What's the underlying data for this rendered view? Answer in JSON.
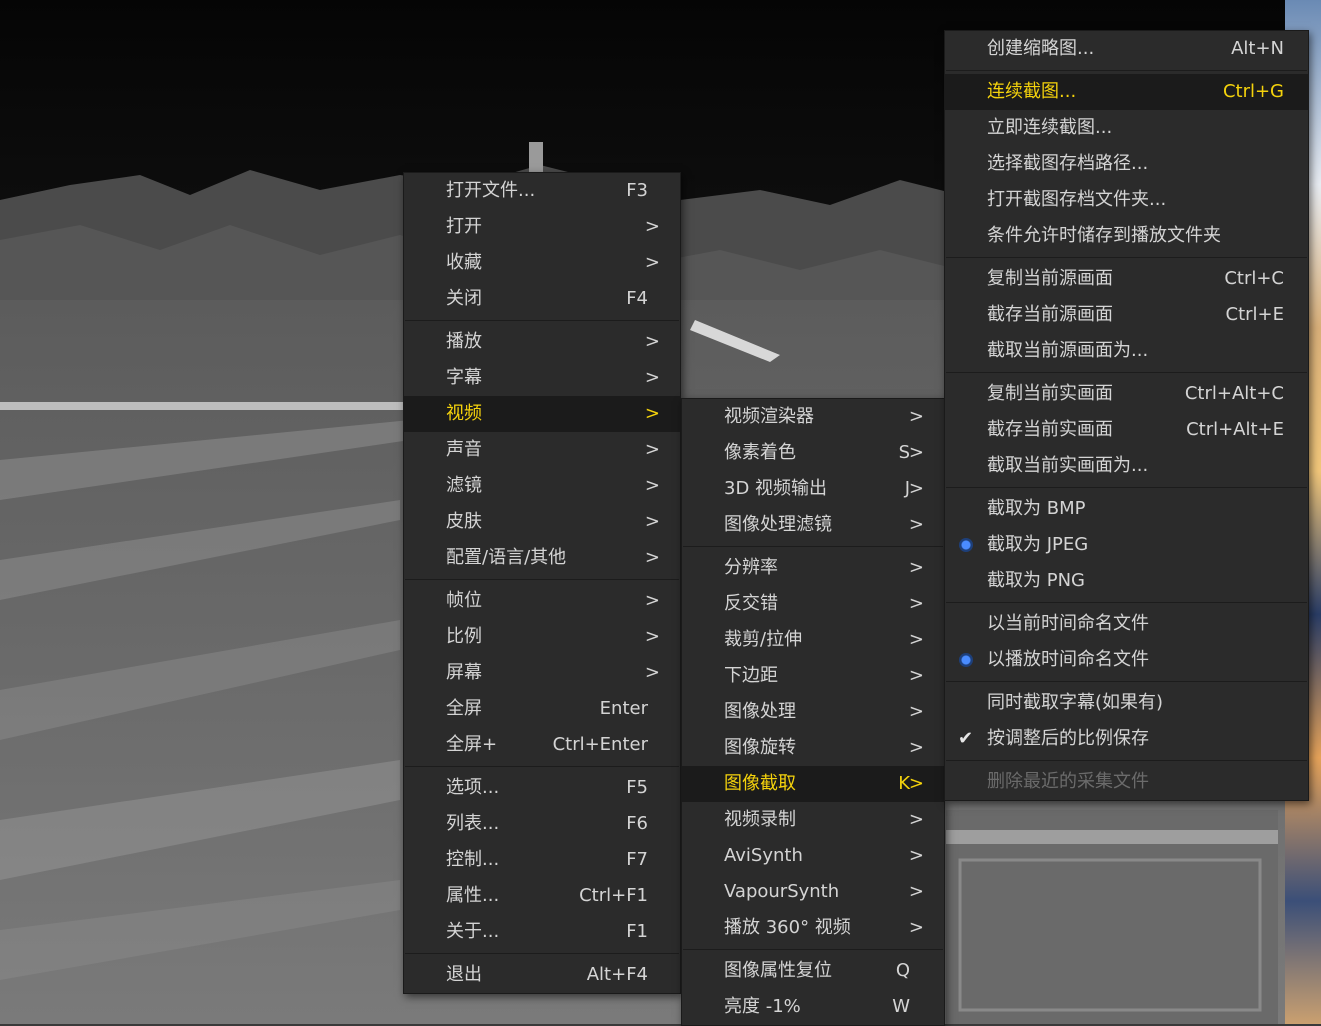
{
  "main_menu": {
    "items": [
      {
        "label": "打开文件...",
        "shortcut": "F3"
      },
      {
        "label": "打开",
        "arrow": ">"
      },
      {
        "label": "收藏",
        "arrow": ">"
      },
      {
        "label": "关闭",
        "shortcut": "F4"
      },
      {
        "label": "播放",
        "arrow": ">"
      },
      {
        "label": "字幕",
        "arrow": ">"
      },
      {
        "label": "视频",
        "arrow": ">"
      },
      {
        "label": "声音",
        "arrow": ">"
      },
      {
        "label": "滤镜",
        "arrow": ">"
      },
      {
        "label": "皮肤",
        "arrow": ">"
      },
      {
        "label": "配置/语言/其他",
        "arrow": ">"
      },
      {
        "label": "帧位",
        "arrow": ">"
      },
      {
        "label": "比例",
        "arrow": ">"
      },
      {
        "label": "屏幕",
        "arrow": ">"
      },
      {
        "label": "全屏",
        "shortcut": "Enter"
      },
      {
        "label": "全屏+",
        "shortcut": "Ctrl+Enter"
      },
      {
        "label": "选项...",
        "shortcut": "F5"
      },
      {
        "label": "列表...",
        "shortcut": "F6"
      },
      {
        "label": "控制...",
        "shortcut": "F7"
      },
      {
        "label": "属性...",
        "shortcut": "Ctrl+F1"
      },
      {
        "label": "关于...",
        "shortcut": "F1"
      },
      {
        "label": "退出",
        "shortcut": "Alt+F4"
      }
    ]
  },
  "video_menu": {
    "items": [
      {
        "label": "视频渲染器",
        "arrow": ">"
      },
      {
        "label": "像素着色",
        "key": "S",
        "arrow": ">"
      },
      {
        "label": "3D 视频输出",
        "key": "J",
        "arrow": ">"
      },
      {
        "label": "图像处理滤镜",
        "arrow": ">"
      },
      {
        "label": "分辨率",
        "arrow": ">"
      },
      {
        "label": "反交错",
        "arrow": ">"
      },
      {
        "label": "裁剪/拉伸",
        "arrow": ">"
      },
      {
        "label": "下边距",
        "arrow": ">"
      },
      {
        "label": "图像处理",
        "arrow": ">"
      },
      {
        "label": "图像旋转",
        "arrow": ">"
      },
      {
        "label": "图像截取",
        "key": "K",
        "arrow": ">"
      },
      {
        "label": "视频录制",
        "arrow": ">"
      },
      {
        "label": "AviSynth",
        "arrow": ">"
      },
      {
        "label": "VapourSynth",
        "arrow": ">"
      },
      {
        "label": "播放 360° 视频",
        "arrow": ">"
      },
      {
        "label": "图像属性复位",
        "shortcut": "Q"
      },
      {
        "label": "亮度 -1%",
        "shortcut": "W"
      }
    ]
  },
  "capture_menu": {
    "items": [
      {
        "label": "创建缩略图...",
        "shortcut": "Alt+N"
      },
      {
        "label": "连续截图...",
        "shortcut": "Ctrl+G"
      },
      {
        "label": "立即连续截图..."
      },
      {
        "label": "选择截图存档路径..."
      },
      {
        "label": "打开截图存档文件夹..."
      },
      {
        "label": "条件允许时储存到播放文件夹"
      },
      {
        "label": "复制当前源画面",
        "shortcut": "Ctrl+C"
      },
      {
        "label": "截存当前源画面",
        "shortcut": "Ctrl+E"
      },
      {
        "label": "截取当前源画面为..."
      },
      {
        "label": "复制当前实画面",
        "shortcut": "Ctrl+Alt+C"
      },
      {
        "label": "截存当前实画面",
        "shortcut": "Ctrl+Alt+E"
      },
      {
        "label": "截取当前实画面为..."
      },
      {
        "label": "截取为 BMP"
      },
      {
        "label": "截取为 JPEG"
      },
      {
        "label": "截取为 PNG"
      },
      {
        "label": "以当前时间命名文件"
      },
      {
        "label": "以播放时间命名文件"
      },
      {
        "label": "同时截取字幕(如果有)"
      },
      {
        "label": "按调整后的比例保存"
      },
      {
        "label": "删除最近的采集文件"
      }
    ]
  }
}
